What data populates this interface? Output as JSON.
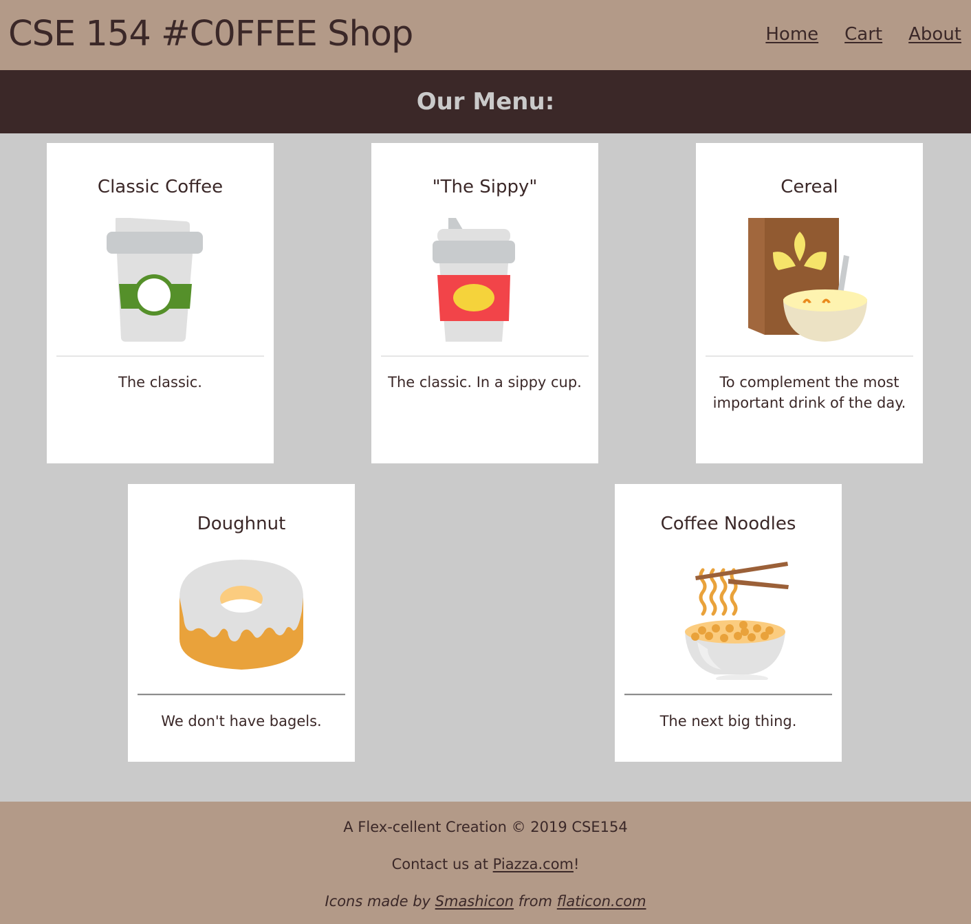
{
  "header": {
    "title": "CSE 154 #C0FFEE Shop",
    "nav": [
      {
        "label": "Home"
      },
      {
        "label": "Cart"
      },
      {
        "label": "About"
      }
    ]
  },
  "banner": {
    "title": "Our Menu:"
  },
  "menu": {
    "items": [
      {
        "name": "Classic Coffee",
        "icon": "coffee-cup-icon",
        "description": "The classic."
      },
      {
        "name": "\"The Sippy\"",
        "icon": "sippy-cup-icon",
        "description": "The classic. In a sippy cup."
      },
      {
        "name": "Cereal",
        "icon": "cereal-icon",
        "description": "To complement the most important drink of the day."
      },
      {
        "name": "Doughnut",
        "icon": "doughnut-icon",
        "description": "We don't have bagels."
      },
      {
        "name": "Coffee Noodles",
        "icon": "noodles-icon",
        "description": "The next big thing."
      }
    ]
  },
  "footer": {
    "creation": "A Flex-cellent Creation © 2019 CSE154",
    "contact_prefix": "Contact us at ",
    "contact_link": "Piazza.com",
    "contact_suffix": "!",
    "credits_prefix": "Icons made by ",
    "credits_author": "Smashicon",
    "credits_middle": " from ",
    "credits_site": "flaticon.com"
  },
  "colors": {
    "header_bg": "#b39a88",
    "banner_bg": "#3b2828",
    "main_bg": "#cacaca",
    "text": "#3b2828",
    "card_bg": "#ffffff"
  }
}
